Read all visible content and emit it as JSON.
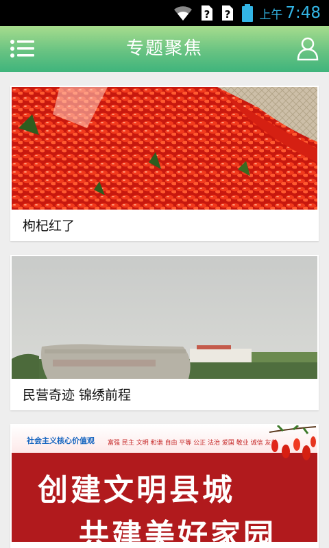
{
  "status_bar": {
    "ampm": "上午",
    "time": "7:48",
    "icons": [
      "wifi-icon",
      "sim-unknown-icon",
      "sim-unknown-icon",
      "battery-icon"
    ]
  },
  "header": {
    "title": "专题聚焦",
    "menu_icon": "menu-list-icon",
    "user_icon": "user-icon"
  },
  "cards": [
    {
      "title": "枸杞红了",
      "image": "red goji berries"
    },
    {
      "title": "民营奇迹 锦绣前程",
      "image": "industrial park stone sign"
    },
    {
      "title": "",
      "image": "banner",
      "banner": {
        "slogan": "社会主义核心价值观",
        "values": "富强 民主 文明 和谐 自由 平等 公正 法治 爱国 敬业 诚信 友善",
        "line1": "创建文明县城",
        "line2": "共建美好家园"
      }
    }
  ]
}
